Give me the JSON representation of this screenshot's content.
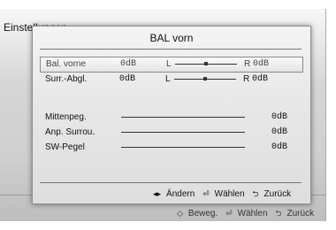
{
  "background_window": {
    "title": "Einstellungen",
    "footer": {
      "move_icon": "◇",
      "move_label": "Beweg.",
      "enter_icon": "⏎",
      "enter_label": "Wählen",
      "back_icon": "⮌",
      "back_label": "Zurück"
    }
  },
  "dialog": {
    "title": "BAL vorn",
    "rows": [
      {
        "label": "Bal. vorne",
        "left_value": "0dB",
        "left_letter": "L",
        "right_letter": "R",
        "right_value": "0dB",
        "balance": 0.5,
        "selected": true
      },
      {
        "label": "Surr.-Abgl.",
        "left_value": "0dB",
        "left_letter": "L",
        "right_letter": "R",
        "right_value": "0dB",
        "balance": 0.5,
        "selected": false
      }
    ],
    "levels": [
      {
        "label": "Mittenpeg.",
        "value": "0dB"
      },
      {
        "label": "Anp. Surrou.",
        "value": "0dB"
      },
      {
        "label": "SW-Pegel",
        "value": "0dB"
      }
    ],
    "footer": {
      "change_icon": "◂▸",
      "change_label": "Ändern",
      "select_icon": "⏎",
      "select_label": "Wählen",
      "back_icon": "⮌",
      "back_label": "Zurück"
    }
  }
}
